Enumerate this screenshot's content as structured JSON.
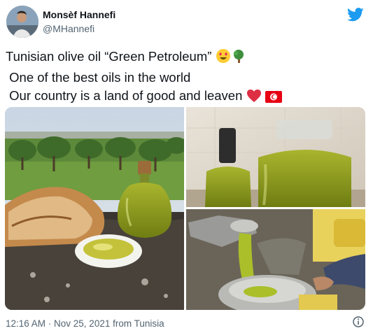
{
  "author": {
    "name": "Monsèf Hannefi",
    "handle": "@MHannefi"
  },
  "tweet": {
    "line1": "Tunisian olive oil “Green Petroleum” ",
    "line2": " One of the best oils in the world",
    "line3": " Our country is a land of good and leaven "
  },
  "footer": {
    "timestamp": "12:16 AM · Nov 25, 2021 from Tunisia"
  },
  "icons": {
    "brand": "twitter-bird-icon",
    "info": "info-icon"
  },
  "colors": {
    "brand_blue": "#1d9bf0",
    "text": "#0f1419",
    "secondary": "#536471"
  }
}
